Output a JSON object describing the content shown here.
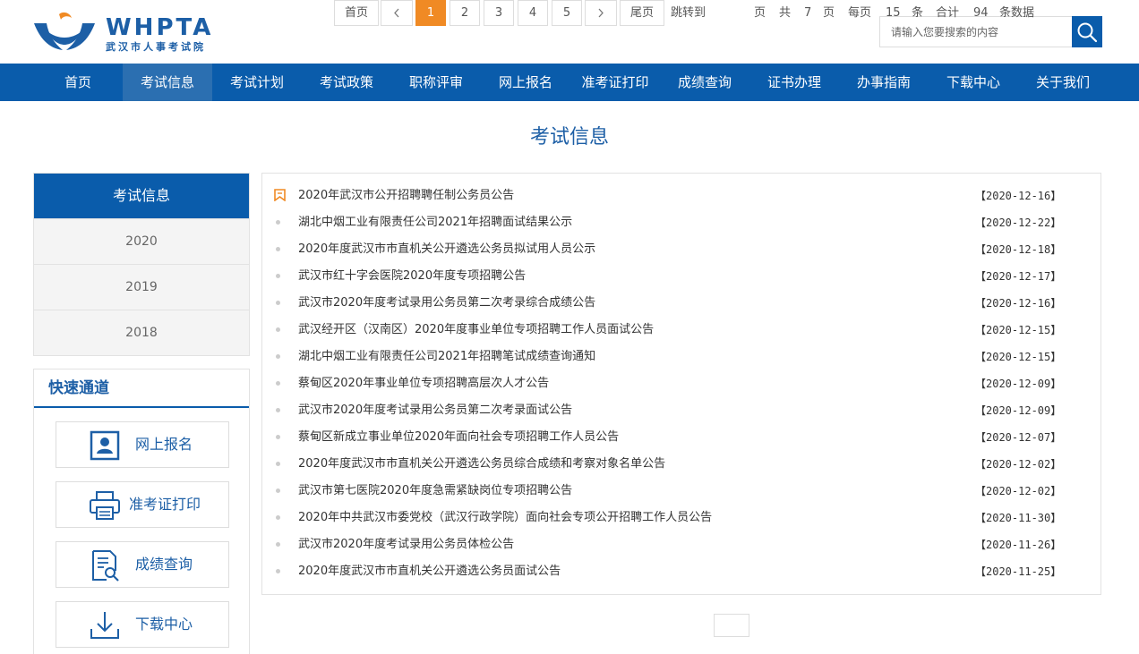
{
  "header": {
    "logo_en": "WHPTA",
    "logo_cn": "武汉市人事考试院",
    "search_placeholder": "请输入您要搜索的内容"
  },
  "nav": [
    {
      "label": "首页",
      "active": false
    },
    {
      "label": "考试信息",
      "active": true
    },
    {
      "label": "考试计划",
      "active": false
    },
    {
      "label": "考试政策",
      "active": false
    },
    {
      "label": "职称评审",
      "active": false
    },
    {
      "label": "网上报名",
      "active": false
    },
    {
      "label": "准考证打印",
      "active": false
    },
    {
      "label": "成绩查询",
      "active": false
    },
    {
      "label": "证书办理",
      "active": false
    },
    {
      "label": "办事指南",
      "active": false
    },
    {
      "label": "下载中心",
      "active": false
    },
    {
      "label": "关于我们",
      "active": false
    }
  ],
  "page_title": "考试信息",
  "sidebar": {
    "title": "考试信息",
    "years": [
      "2020",
      "2019",
      "2018"
    ]
  },
  "quick": {
    "title": "快速通道",
    "items": [
      {
        "label": "网上报名",
        "icon": "id-card-icon"
      },
      {
        "label": "准考证打印",
        "icon": "printer-icon"
      },
      {
        "label": "成绩查询",
        "icon": "document-search-icon"
      },
      {
        "label": "下载中心",
        "icon": "download-icon"
      }
    ]
  },
  "articles": [
    {
      "title": "2020年武汉市公开招聘聘任制公务员公告",
      "date": "【2020-12-16】",
      "pinned": true
    },
    {
      "title": "湖北中烟工业有限责任公司2021年招聘面试结果公示",
      "date": "【2020-12-22】",
      "pinned": false
    },
    {
      "title": "2020年度武汉市市直机关公开遴选公务员拟试用人员公示",
      "date": "【2020-12-18】",
      "pinned": false
    },
    {
      "title": "武汉市红十字会医院2020年度专项招聘公告",
      "date": "【2020-12-17】",
      "pinned": false
    },
    {
      "title": "武汉市2020年度考试录用公务员第二次考录综合成绩公告",
      "date": "【2020-12-16】",
      "pinned": false
    },
    {
      "title": "武汉经开区（汉南区）2020年度事业单位专项招聘工作人员面试公告",
      "date": "【2020-12-15】",
      "pinned": false
    },
    {
      "title": "湖北中烟工业有限责任公司2021年招聘笔试成绩查询通知",
      "date": "【2020-12-15】",
      "pinned": false
    },
    {
      "title": "蔡甸区2020年事业单位专项招聘高层次人才公告",
      "date": "【2020-12-09】",
      "pinned": false
    },
    {
      "title": "武汉市2020年度考试录用公务员第二次考录面试公告",
      "date": "【2020-12-09】",
      "pinned": false
    },
    {
      "title": "蔡甸区新成立事业单位2020年面向社会专项招聘工作人员公告",
      "date": "【2020-12-07】",
      "pinned": false
    },
    {
      "title": "2020年度武汉市市直机关公开遴选公务员综合成绩和考察对象名单公告",
      "date": "【2020-12-02】",
      "pinned": false
    },
    {
      "title": "武汉市第七医院2020年度急需紧缺岗位专项招聘公告",
      "date": "【2020-12-02】",
      "pinned": false
    },
    {
      "title": "2020年中共武汉市委党校（武汉行政学院）面向社会专项公开招聘工作人员公告",
      "date": "【2020-11-30】",
      "pinned": false
    },
    {
      "title": "武汉市2020年度考试录用公务员体检公告",
      "date": "【2020-11-26】",
      "pinned": false
    },
    {
      "title": "2020年度武汉市市直机关公开遴选公务员面试公告",
      "date": "【2020-11-25】",
      "pinned": false
    }
  ],
  "pagination": {
    "first": "首页",
    "prev": "‹",
    "pages": [
      "1",
      "2",
      "3",
      "4",
      "5"
    ],
    "current": "1",
    "next": "›",
    "last": "尾页",
    "jump_label": "跳转到",
    "page_unit": "页",
    "total_label": "共",
    "total_pages": "7",
    "total_pages_unit": "页",
    "per_page_label": "每页",
    "per_page": "15",
    "per_page_unit": "条",
    "sum_label": "合计",
    "total_items": "94",
    "total_items_unit": "条数据"
  },
  "colors": {
    "brand_blue": "#0a5cab",
    "nav_active": "#2b6fb1",
    "accent_orange": "#f08a24"
  }
}
